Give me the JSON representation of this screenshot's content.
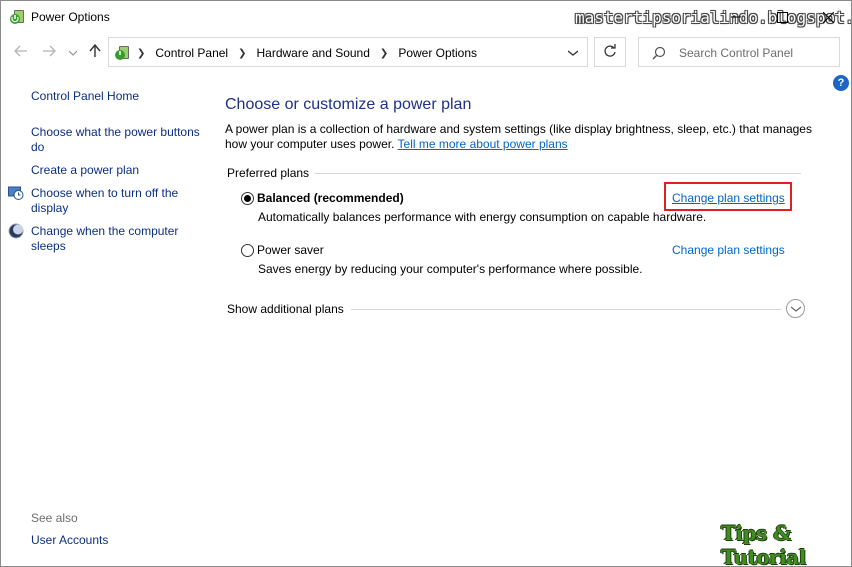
{
  "window": {
    "title": "Power Options",
    "watermark": "mastertipsorialindo.blogspot.com"
  },
  "nav": {
    "breadcrumbs": [
      "Control Panel",
      "Hardware and Sound",
      "Power Options"
    ],
    "search_placeholder": "Search Control Panel"
  },
  "help": {
    "label": "?"
  },
  "sidebar": {
    "home": "Control Panel Home",
    "items": [
      {
        "label": "Choose what the power buttons do"
      },
      {
        "label": "Create a power plan"
      },
      {
        "label": "Choose when to turn off the display"
      },
      {
        "label": "Change when the computer sleeps"
      }
    ],
    "see_also_title": "See also",
    "see_also_items": [
      {
        "label": "User Accounts"
      }
    ]
  },
  "main": {
    "title": "Choose or customize a power plan",
    "intro": "A power plan is a collection of hardware and system settings (like display brightness, sleep, etc.) that manages how your computer uses power.",
    "intro_link": "Tell me more about power plans",
    "preferred_label": "Preferred plans",
    "plans": [
      {
        "name": "Balanced (recommended)",
        "description": "Automatically balances performance with energy consumption on capable hardware.",
        "link": "Change plan settings",
        "selected": true
      },
      {
        "name": "Power saver",
        "description": "Saves energy by reducing your computer's performance where possible.",
        "link": "Change plan settings",
        "selected": false
      }
    ],
    "show_additional": "Show additional plans"
  },
  "branding": {
    "bottom_watermark": "Tips & Tutorial"
  },
  "colors": {
    "link": "#0066cc",
    "title": "#1e3287",
    "highlight": "#e02020",
    "sidebar_link": "#0b2f86"
  },
  "icons": [
    "power-options-icon",
    "minimize-icon",
    "maximize-icon",
    "close-icon",
    "back-arrow-icon",
    "forward-arrow-icon",
    "chevron-down-icon",
    "up-arrow-icon",
    "refresh-icon",
    "search-icon",
    "help-icon",
    "display-clock-icon",
    "moon-sleep-icon",
    "expand-chevron-icon"
  ]
}
